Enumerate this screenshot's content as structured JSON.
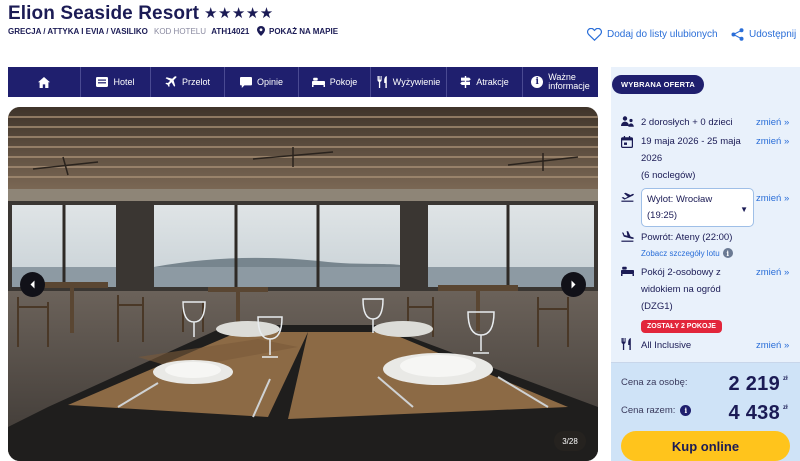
{
  "hotel": {
    "name": "Elion Seaside Resort",
    "stars": "★★★★★",
    "breadcrumb": "GRECJA / ATTYKA I EVIA / VASILIKO",
    "code_label": "KOD HOTELU",
    "code_value": "ATH14021",
    "map_link": "POKAŻ NA MAPIE",
    "favorite_link": "Dodaj do listy ulubionych",
    "share_link": "Udostępnij"
  },
  "nav": {
    "items": [
      {
        "label": "",
        "icon": "home-icon"
      },
      {
        "label": "Hotel",
        "icon": "hotel-icon"
      },
      {
        "label": "Przelot",
        "icon": "plane-icon"
      },
      {
        "label": "Opinie",
        "icon": "chat-icon"
      },
      {
        "label": "Pokoje",
        "icon": "bed-icon"
      },
      {
        "label": "Wyżywienie",
        "icon": "cutlery-icon"
      },
      {
        "label": "Atrakcje",
        "icon": "signpost-icon"
      },
      {
        "label": "Ważne informacje",
        "label_lines": [
          "Ważne",
          "informacje"
        ],
        "icon": "info-icon"
      }
    ]
  },
  "gallery": {
    "counter": "3/28",
    "current": 3,
    "total": 28
  },
  "offer": {
    "badge": "WYBRANA OFERTA",
    "change_label": "zmień »",
    "travelers": "2 dorosłych + 0 dzieci",
    "dates_line1": "19 maja 2026 - 25 maja",
    "dates_line2": "2026",
    "nights": "(6 noclegów)",
    "departure_line1": "Wylot: Wrocław",
    "departure_line2": "(19:25)",
    "return": "Powrót: Ateny (22:00)",
    "flight_details": "Zobacz szczegóły lotu",
    "room_line1": "Pokój 2-osobowy z",
    "room_line2": "widokiem na ogród",
    "room_line3": "(DZG1)",
    "rooms_left": "ZOSTAŁY 2 POKOJE",
    "board": "All Inclusive",
    "price_per_person_label": "Cena za osobę:",
    "price_per_person": "2 219",
    "price_total_label": "Cena razem:",
    "price_total": "4 438",
    "currency": "zł",
    "book_button": "Kup online"
  },
  "colors": {
    "navy": "#1f1f6e",
    "link_blue": "#2a6ed8",
    "panel_bg": "#e9f1fb",
    "price_bg": "#cfe3f7",
    "cta_yellow": "#ffc41c",
    "alert_red": "#e2263b"
  }
}
